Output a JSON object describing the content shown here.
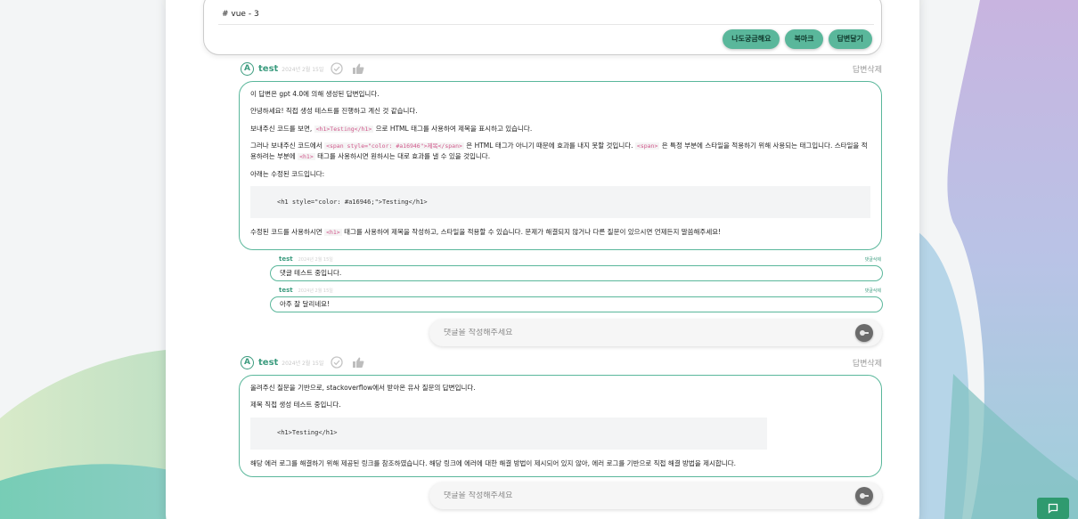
{
  "question": {
    "tag": "# vue - 3",
    "buttons": [
      "나도궁금해요",
      "북마크",
      "답변달기"
    ]
  },
  "answers": [
    {
      "avatar": "A",
      "author": "test",
      "date": "2024년 2월 15일",
      "delete_label": "답변삭제",
      "paragraphs": {
        "p1": "이 답변은 gpt 4.0에 의해 생성된 답변입니다.",
        "p2": "안녕하세요! 직접 생성 테스트를 진행하고 계신 것 같습니다.",
        "p3a": "보내주신 코드를 보면, ",
        "p3code": "<h1>Testing</h1>",
        "p3b": " 으로 HTML 태그를 사용하여 제목을 표시하고 있습니다.",
        "p4a": "그러나 보내주신 코드에서 ",
        "p4code1": "<span style=\"color: #a16946\">제목</span>",
        "p4b": " 은 HTML 태그가 아니기 때문에 효과를 내지 못할 것입니다. ",
        "p4code2": "<span>",
        "p4c": " 은 특정 부분에 스타일을 적용하기 위해 사용되는 태그입니다. 스타일을 적용하려는 부분에 ",
        "p4code3": "<h1>",
        "p4d": " 태그를 사용하시면 원하시는 대로 효과를 낼 수 있을 것입니다.",
        "p5": "아래는 수정된 코드입니다:",
        "code": "<h1 style=\"color: #a16946;\">Testing</h1>",
        "p6a": "수정된 코드를 사용하시면 ",
        "p6code": "<h1>",
        "p6b": " 태그를 사용하여 제목을 작성하고, 스타일을 적용할 수 있습니다. 문제가 해결되지 않거나 다른 질문이 있으시면 언제든지 말씀해주세요!"
      },
      "comments": [
        {
          "author": "test",
          "date": "2024년 2월 15일",
          "delete_label": "댓글삭제",
          "text": "댓글 테스트 중입니다."
        },
        {
          "author": "test",
          "date": "2024년 2월 15일",
          "delete_label": "댓글삭제",
          "text": "아주 잘 달리네요!"
        }
      ],
      "comment_placeholder": "댓글을 작성해주세요"
    },
    {
      "avatar": "A",
      "author": "test",
      "date": "2024년 2월 15일",
      "delete_label": "답변삭제",
      "paragraphs": {
        "p1": "올려주신 질문을 기반으로, stackoverflow에서 받아온 유사 질문의 답변입니다.",
        "p2": "제목 직접 생성 테스트 중입니다.",
        "code": "<h1>Testing</h1>",
        "p3": "해당 에러 로그를 해결하기 위해 제공된 링크를 참조하였습니다. 해당 링크에 에러에 대한 해결 방법이 제시되어 있지 않아, 에러 로그를 기반으로 직접 해결 방법을 제시합니다."
      },
      "comment_placeholder": "댓글을 작성해주세요"
    }
  ],
  "colors": {
    "accent": "#5ab79b",
    "accent_dark": "#3c9c7f",
    "code_pink": "#d0578a",
    "fab": "#2f9a6f"
  },
  "icons": {
    "avatar": "avatar-circle-icon",
    "check": "check-circle-icon",
    "thumb": "thumbs-up-icon",
    "send": "send-key-icon",
    "chat": "chat-bubble-icon"
  }
}
